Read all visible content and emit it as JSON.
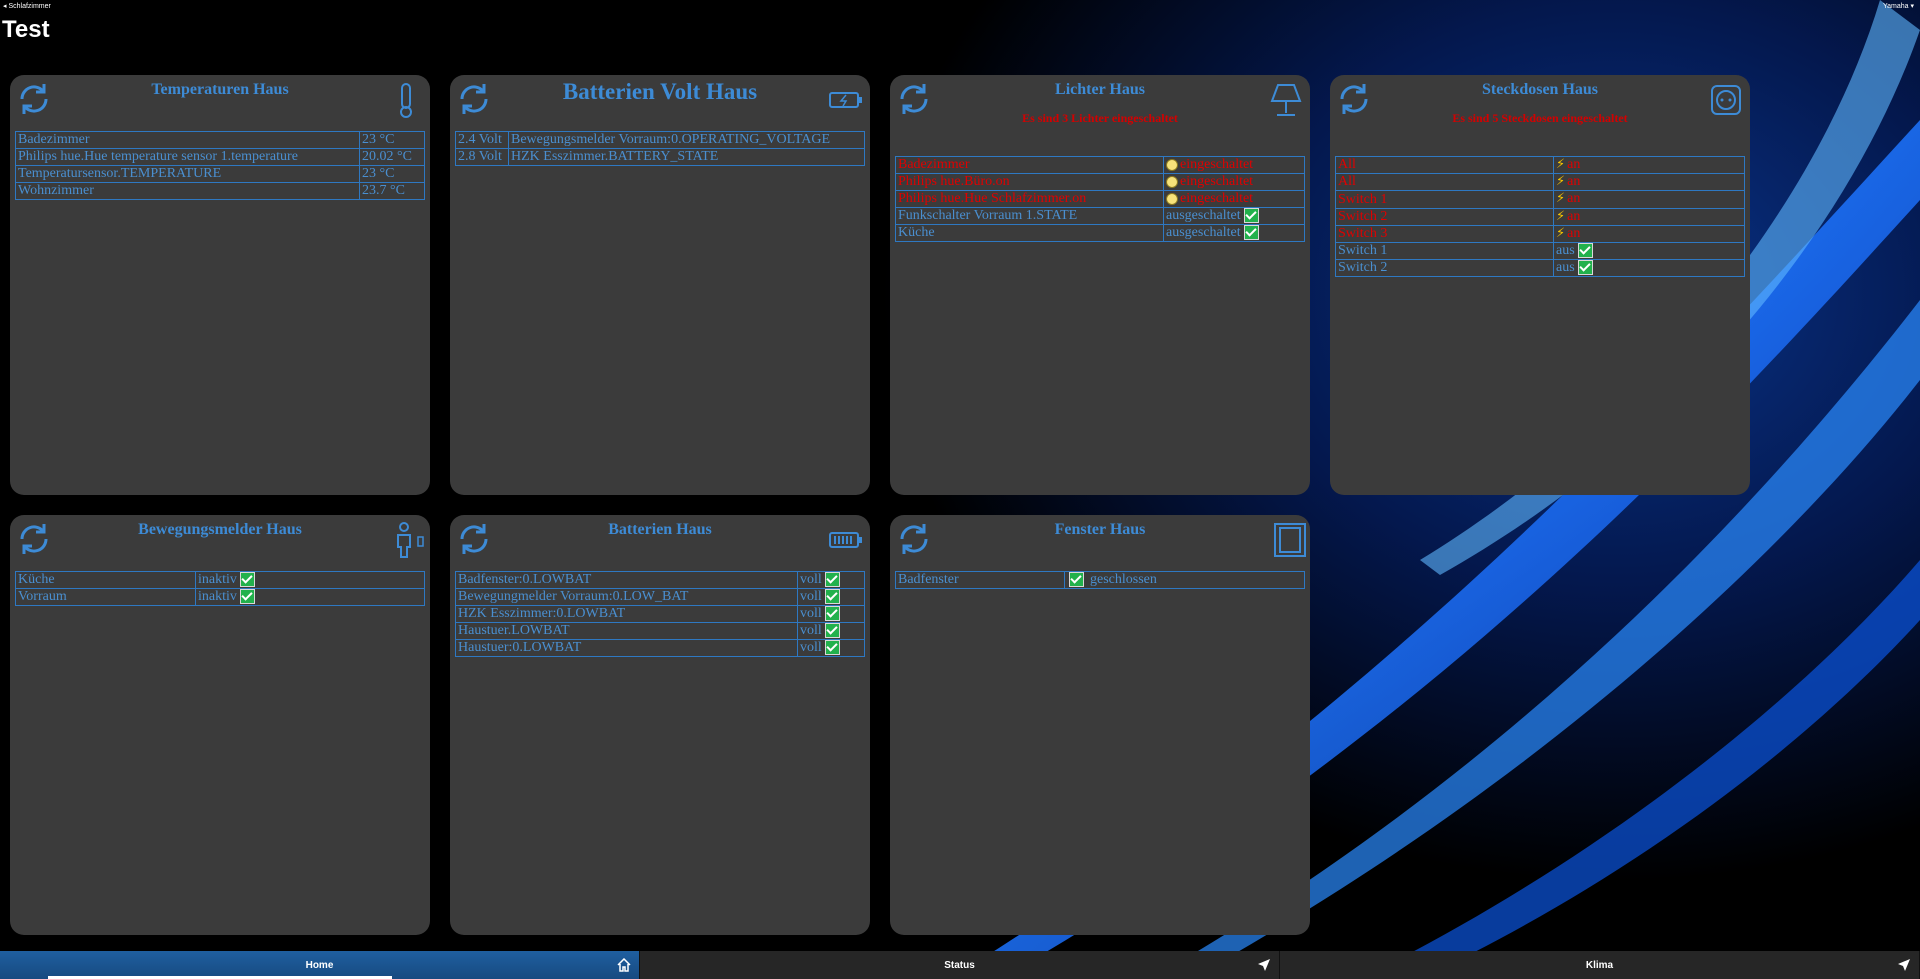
{
  "topbar": {
    "left": "◂ Schlafzimmer",
    "right": "Yamaha ▾"
  },
  "page_title": "Test",
  "cards": {
    "temperaturen": {
      "title": "Temperaturen Haus",
      "rows": [
        {
          "name": "Badezimmer",
          "value": "23 °C"
        },
        {
          "name": "Philips hue.Hue temperature sensor 1.temperature",
          "value": "20.02 °C"
        },
        {
          "name": "Temperatursensor.TEMPERATURE",
          "value": "23 °C"
        },
        {
          "name": "Wohnzimmer",
          "value": "23.7 °C"
        }
      ]
    },
    "batterien_volt": {
      "title": "Batterien Volt Haus",
      "rows": [
        {
          "value": "2.4 Volt",
          "name": "Bewegungsmelder Vorraum:0.OPERATING_VOLTAGE"
        },
        {
          "value": "2.8 Volt",
          "name": "HZK Esszimmer.BATTERY_STATE"
        }
      ]
    },
    "lichter": {
      "title": "Lichter Haus",
      "warning": "Es sind 3 Lichter eingeschaltet",
      "rows": [
        {
          "name": "Badezimmer",
          "state": "eingeschaltet",
          "on": true
        },
        {
          "name": "Philips hue.Büro.on",
          "state": "eingeschaltet",
          "on": true
        },
        {
          "name": "Philips hue.Hue Schlafzimmer.on",
          "state": "eingeschaltet",
          "on": true
        },
        {
          "name": "Funkschalter Vorraum 1.STATE",
          "state": "ausgeschaltet",
          "on": false
        },
        {
          "name": "Küche",
          "state": "ausgeschaltet",
          "on": false
        }
      ]
    },
    "steckdosen": {
      "title": "Steckdosen Haus",
      "warning": "Es sind 5 Steckdosen eingeschaltet",
      "rows": [
        {
          "name": "All",
          "state": "an",
          "on": true
        },
        {
          "name": "All",
          "state": "an",
          "on": true
        },
        {
          "name": "Switch 1",
          "state": "an",
          "on": true
        },
        {
          "name": "Switch 2",
          "state": "an",
          "on": true
        },
        {
          "name": "Switch 3",
          "state": "an",
          "on": true
        },
        {
          "name": "Switch 1",
          "state": "aus",
          "on": false
        },
        {
          "name": "Switch 2",
          "state": "aus",
          "on": false
        }
      ]
    },
    "bewegungsmelder": {
      "title": "Bewegungsmelder Haus",
      "rows": [
        {
          "name": "Küche",
          "state": "inaktiv"
        },
        {
          "name": "Vorraum",
          "state": "inaktiv"
        }
      ]
    },
    "batterien": {
      "title": "Batterien Haus",
      "rows": [
        {
          "name": "Badfenster:0.LOWBAT",
          "state": "voll"
        },
        {
          "name": "Bewegungmelder Vorraum:0.LOW_BAT",
          "state": "voll"
        },
        {
          "name": "HZK Esszimmer:0.LOWBAT",
          "state": "voll"
        },
        {
          "name": "Haustuer.LOWBAT",
          "state": "voll"
        },
        {
          "name": "Haustuer:0.LOWBAT",
          "state": "voll"
        }
      ]
    },
    "fenster": {
      "title": "Fenster Haus",
      "rows": [
        {
          "name": "Badfenster",
          "state": "geschlossen"
        }
      ]
    }
  },
  "nav": [
    {
      "label": "Home",
      "icon": "home-icon",
      "active": true
    },
    {
      "label": "Status",
      "icon": "navigation-arrow-icon",
      "active": false
    },
    {
      "label": "Klima",
      "icon": "navigation-arrow-icon",
      "active": false
    }
  ],
  "colors": {
    "card_bg": "#3b3b3b",
    "accent": "#3d8bd6",
    "alert": "#e00000",
    "nav_active": "#1f5fa0"
  }
}
